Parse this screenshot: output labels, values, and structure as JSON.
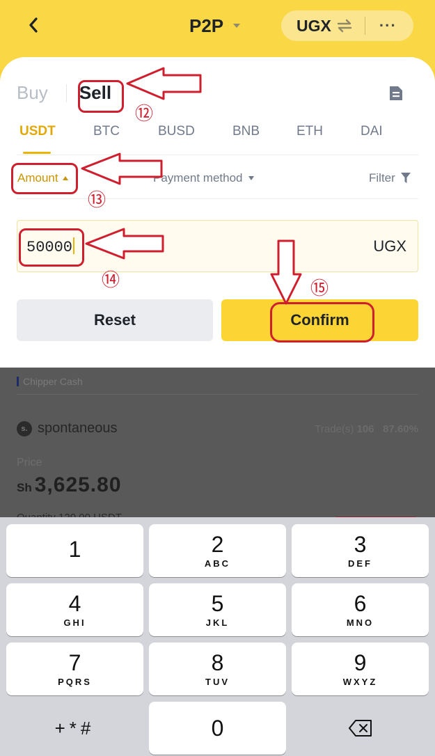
{
  "header": {
    "title": "P2P",
    "currency": "UGX"
  },
  "trade_tabs": [
    "Buy",
    "Sell"
  ],
  "asset_tabs": [
    "USDT",
    "BTC",
    "BUSD",
    "BNB",
    "ETH",
    "DAI"
  ],
  "filters": {
    "amount": "Amount",
    "payment_method": "Payment method",
    "filter": "Filter"
  },
  "amount_input": {
    "value": "50000",
    "unit": "UGX"
  },
  "buttons": {
    "reset": "Reset",
    "confirm": "Confirm"
  },
  "listing": {
    "payment_tag": "Chipper Cash",
    "merchant": "spontaneous",
    "merchant_initial": "s.",
    "trades_label": "Trade(s)",
    "trades_count": "106",
    "completion": "87.60%",
    "price_label": "Price",
    "price_currency": "Sh",
    "price": "3,625.80",
    "quantity": "Quantity 120.00 USDT"
  },
  "keyboard": {
    "k1": {
      "digit": "1",
      "letters": ""
    },
    "k2": {
      "digit": "2",
      "letters": "ABC"
    },
    "k3": {
      "digit": "3",
      "letters": "DEF"
    },
    "k4": {
      "digit": "4",
      "letters": "GHI"
    },
    "k5": {
      "digit": "5",
      "letters": "JKL"
    },
    "k6": {
      "digit": "6",
      "letters": "MNO"
    },
    "k7": {
      "digit": "7",
      "letters": "PQRS"
    },
    "k8": {
      "digit": "8",
      "letters": "TUV"
    },
    "k9": {
      "digit": "9",
      "letters": "WXYZ"
    },
    "k0": {
      "digit": "0",
      "letters": ""
    },
    "symbols": "+*#"
  },
  "annotations": [
    "⑫",
    "⑬",
    "⑭",
    "⑮"
  ],
  "colors": {
    "brand_yellow": "#FCD535",
    "accent_gold": "#C99400",
    "annotation_red": "#CF1F2E"
  }
}
